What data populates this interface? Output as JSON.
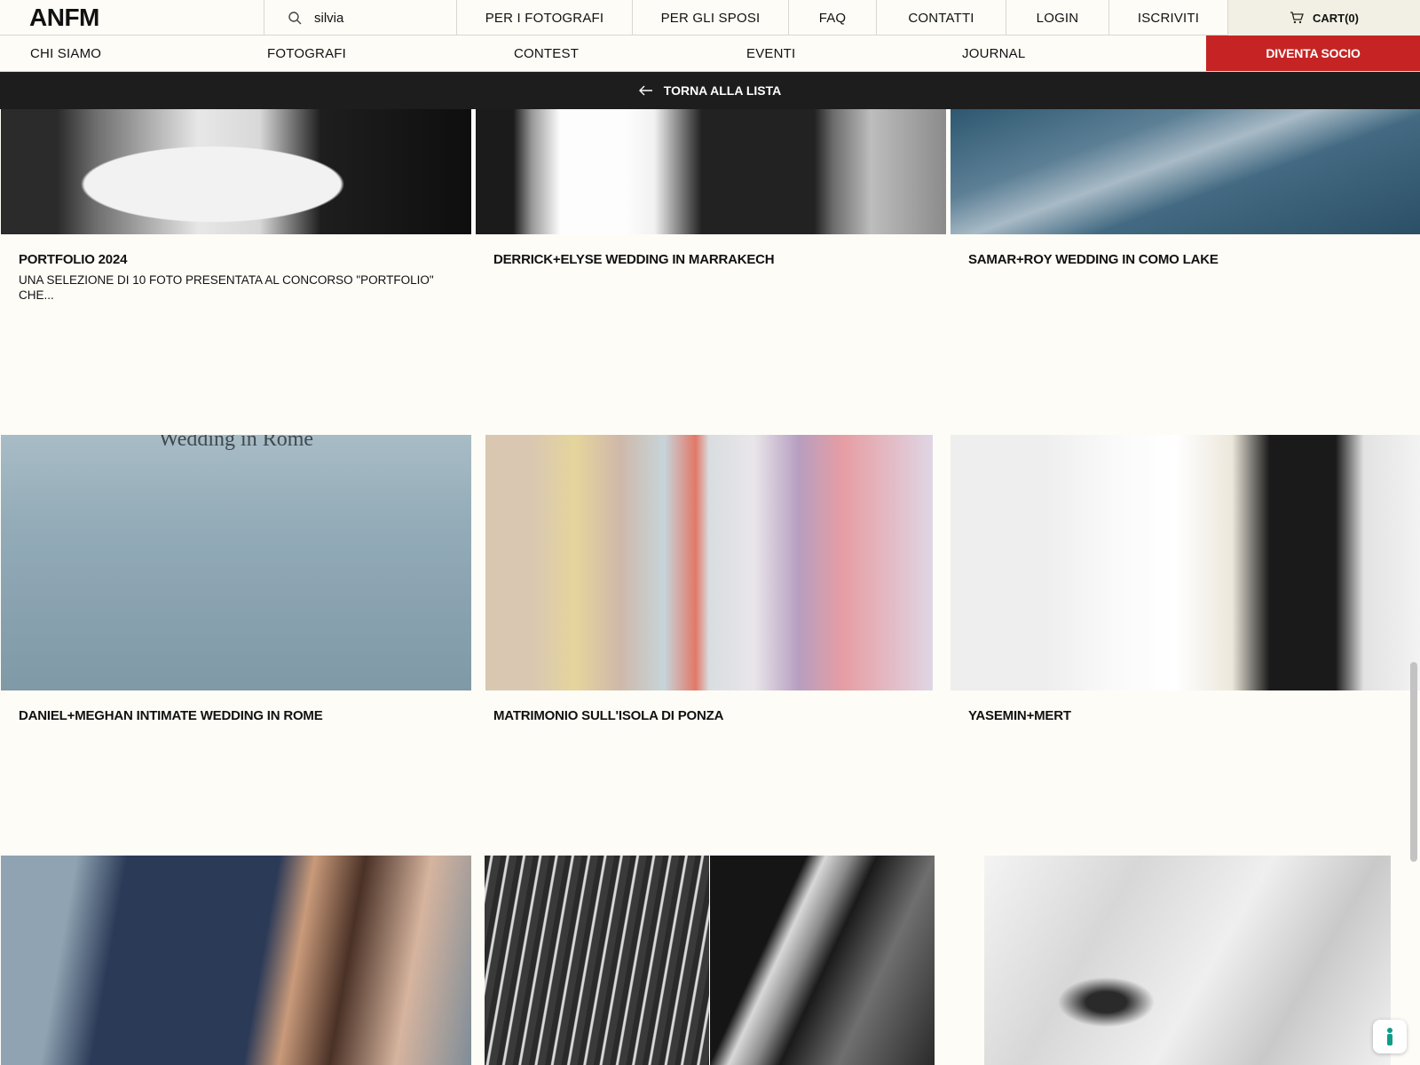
{
  "header": {
    "logo": "ANFM",
    "search_value": "silvia",
    "nav": [
      "PER I FOTOGRAFI",
      "PER GLI SPOSI",
      "FAQ",
      "CONTATTI",
      "LOGIN",
      "ISCRIVITI"
    ],
    "cart_label": "CART(0)"
  },
  "subnav": {
    "items": [
      "CHI SIAMO",
      "FOTOGRAFI",
      "CONTEST",
      "EVENTI",
      "JOURNAL"
    ],
    "cta_label": "DIVENTA SOCIO"
  },
  "back_label": "TORNA ALLA LISTA",
  "cards": [
    {
      "title": "PORTFOLIO 2024",
      "description": "UNA SELEZIONE DI 10 FOTO PRESENTATA AL CONCORSO \"PORTFOLIO\" CHE..."
    },
    {
      "title": "DERRICK+ELYSE WEDDING IN MARRAKECH"
    },
    {
      "title": "SAMAR+ROY WEDDING IN COMO LAKE"
    },
    {
      "title": "DANIEL+MEGHAN INTIMATE WEDDING IN ROME",
      "image_text": "Wedding in Rome"
    },
    {
      "title": "MATRIMONIO SULL'ISOLA DI PONZA"
    },
    {
      "title": "YASEMIN+MERT"
    }
  ],
  "colors": {
    "accent": "#c62424",
    "background": "#fdfcf7",
    "backbar": "#1d1d1d"
  }
}
